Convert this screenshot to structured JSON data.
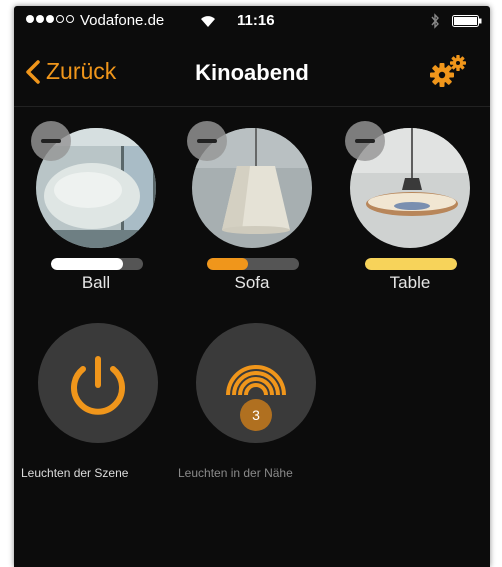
{
  "status_bar": {
    "signal": [
      true,
      true,
      true,
      false,
      false
    ],
    "carrier": "Vodafone.de",
    "time": "11:16",
    "wifi_icon": "wifi-icon",
    "bluetooth_icon": "bluetooth-icon",
    "battery_icon": "battery-icon",
    "battery_level": 1.0
  },
  "nav": {
    "back_label": "Zurück",
    "back_icon": "chevron-left-icon",
    "title": "Kinoabend",
    "settings_icon": "gears-icon"
  },
  "lamps": [
    {
      "label": "Ball",
      "level": 0.78,
      "color": "#ffffff"
    },
    {
      "label": "Sofa",
      "level": 0.45,
      "color": "#f0961b"
    },
    {
      "label": "Table",
      "level": 1.0,
      "color": "#f7d35a"
    }
  ],
  "actions": {
    "power_icon": "power-icon",
    "nearby_icon": "signal-waves-icon",
    "nearby_count": "3"
  },
  "labels": {
    "scene_lights": "Leuchten der Szene",
    "nearby_lights": "Leuchten in der Nähe"
  },
  "colors": {
    "accent": "#f0961b",
    "background": "#0c0c0c",
    "button_bg": "#3a3a3a"
  }
}
